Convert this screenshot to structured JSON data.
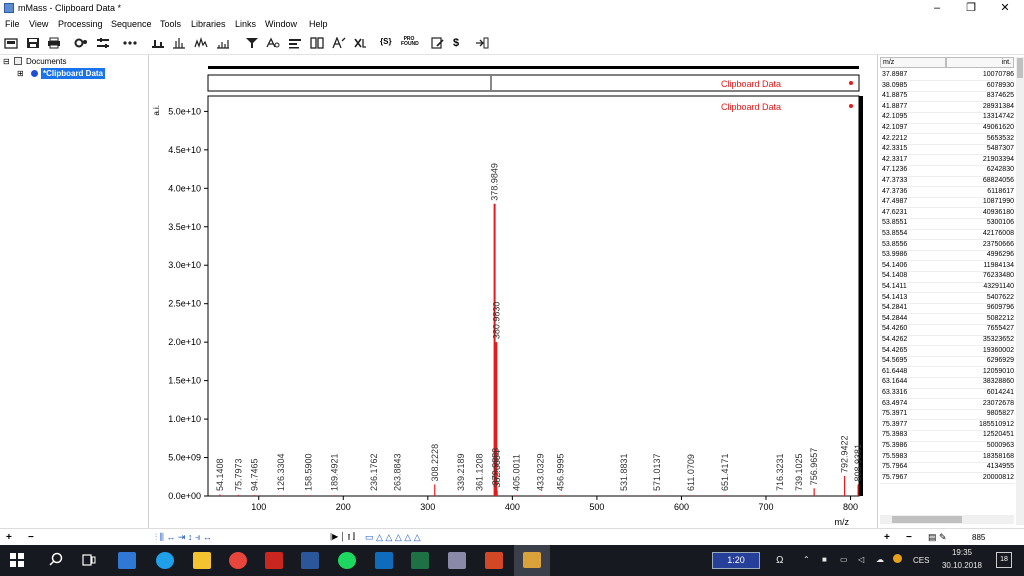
{
  "window": {
    "title": "mMass - Clipboard Data *"
  },
  "menu": [
    "File",
    "View",
    "Processing",
    "Sequence",
    "Tools",
    "Libraries",
    "Links",
    "Window",
    "Help"
  ],
  "toolbar": {
    "icons": [
      "open-icon",
      "save-icon",
      "print-icon",
      "gear-icon",
      "options-icon",
      "more-icon",
      "baseline-icon",
      "peak-picking-icon",
      "smoothing-icon",
      "deisotope-icon",
      "filter-icon",
      "match-icon",
      "compare-icon",
      "mass-filter-icon",
      "envelope-icon",
      "delete-icon",
      "formula-icon",
      "profound-icon",
      "report-icon",
      "currency-icon",
      "export-icon"
    ],
    "profound_label": "PRO FOUND",
    "formula_label": "{S}"
  },
  "tree": {
    "root": "Documents",
    "child": "*Clipboard Data"
  },
  "plot": {
    "legend": "Clipboard Data",
    "top_legend": "Clipboard Data",
    "ylabel": "a.i.",
    "xlabel": "m/z"
  },
  "chart_data": {
    "type": "line",
    "xlabel": "m/z",
    "ylabel": "a.i.",
    "xlim": [
      40,
      810
    ],
    "ylim": [
      0,
      52000000000
    ],
    "x_ticks": [
      100,
      200,
      300,
      400,
      500,
      600,
      700,
      800
    ],
    "y_ticks": [
      0,
      5000000000,
      10000000000,
      15000000000,
      20000000000,
      25000000000,
      30000000000,
      35000000000,
      40000000000,
      45000000000,
      50000000000
    ],
    "y_tick_labels": [
      "0.0e+00",
      "5.0e+09",
      "1.0e+10",
      "1.5e+10",
      "2.0e+10",
      "2.5e+10",
      "3.0e+10",
      "3.5e+10",
      "4.0e+10",
      "4.5e+10",
      "5.0e+10"
    ],
    "peaks": [
      {
        "mz": 54.1408,
        "label": "54.1408",
        "intensity": 200000000
      },
      {
        "mz": 75.7973,
        "label": "75.7973",
        "intensity": 150000000
      },
      {
        "mz": 94.7465,
        "label": "94.7465",
        "intensity": 120000000
      },
      {
        "mz": 126.3304,
        "label": "126.3304",
        "intensity": 100000000
      },
      {
        "mz": 158.59,
        "label": "158.5900",
        "intensity": 100000000
      },
      {
        "mz": 189.4921,
        "label": "189.4921",
        "intensity": 100000000
      },
      {
        "mz": 236.1762,
        "label": "236.1762",
        "intensity": 100000000
      },
      {
        "mz": 263.8843,
        "label": "263.8843",
        "intensity": 100000000
      },
      {
        "mz": 308.2228,
        "label": "308.2228",
        "intensity": 1500000000
      },
      {
        "mz": 339.2189,
        "label": "339.2189",
        "intensity": 100000000
      },
      {
        "mz": 361.1208,
        "label": "361.1208",
        "intensity": 100000000
      },
      {
        "mz": 378.9849,
        "label": "378.9849",
        "intensity": 38000000000
      },
      {
        "mz": 379.9883,
        "label": "379.9883",
        "intensity": 1000000000
      },
      {
        "mz": 380.983,
        "label": "380.9830",
        "intensity": 20000000000
      },
      {
        "mz": 382.0004,
        "label": "382.0004",
        "intensity": 700000000
      },
      {
        "mz": 405.0011,
        "label": "405.0011",
        "intensity": 100000000
      },
      {
        "mz": 433.0329,
        "label": "433.0329",
        "intensity": 100000000
      },
      {
        "mz": 456.9995,
        "label": "456.9995",
        "intensity": 100000000
      },
      {
        "mz": 531.8831,
        "label": "531.8831",
        "intensity": 100000000
      },
      {
        "mz": 571.0137,
        "label": "571.0137",
        "intensity": 100000000
      },
      {
        "mz": 611.0709,
        "label": "611.0709",
        "intensity": 100000000
      },
      {
        "mz": 651.4171,
        "label": "651.4171",
        "intensity": 100000000
      },
      {
        "mz": 716.3231,
        "label": "716.3231",
        "intensity": 100000000
      },
      {
        "mz": 739.1025,
        "label": "739.1025",
        "intensity": 100000000
      },
      {
        "mz": 756.9657,
        "label": "756.9657",
        "intensity": 1000000000
      },
      {
        "mz": 792.9422,
        "label": "792.9422",
        "intensity": 2600000000
      },
      {
        "mz": 808.9381,
        "label": "808.9381",
        "intensity": 1500000000
      }
    ],
    "colors": {
      "spectrum": "#e41a1c",
      "axes": "#000000",
      "labels": "#333333"
    }
  },
  "peaklist": {
    "col_mz": "m/z",
    "col_int": "int.",
    "rows": [
      [
        "37.8987",
        "10070786"
      ],
      [
        "38.0985",
        "6078930"
      ],
      [
        "41.8875",
        "8374625"
      ],
      [
        "41.8877",
        "28931384"
      ],
      [
        "42.1095",
        "13314742"
      ],
      [
        "42.1097",
        "49061620"
      ],
      [
        "42.2212",
        "5653532"
      ],
      [
        "42.3315",
        "5487307"
      ],
      [
        "42.3317",
        "21903394"
      ],
      [
        "47.1236",
        "6242830"
      ],
      [
        "47.3733",
        "68824056"
      ],
      [
        "47.3736",
        "6118617"
      ],
      [
        "47.4987",
        "10871990"
      ],
      [
        "47.6231",
        "40936180"
      ],
      [
        "53.8551",
        "5300106"
      ],
      [
        "53.8554",
        "42176008"
      ],
      [
        "53.8556",
        "23750666"
      ],
      [
        "53.9986",
        "4996296"
      ],
      [
        "54.1406",
        "11984134"
      ],
      [
        "54.1408",
        "76233480"
      ],
      [
        "54.1411",
        "43291140"
      ],
      [
        "54.1413",
        "5407622"
      ],
      [
        "54.2841",
        "9609796"
      ],
      [
        "54.2844",
        "5082212"
      ],
      [
        "54.4260",
        "7655427"
      ],
      [
        "54.4262",
        "35323652"
      ],
      [
        "54.4265",
        "19360002"
      ],
      [
        "54.5695",
        "6296929"
      ],
      [
        "61.6448",
        "12059010"
      ],
      [
        "63.1644",
        "38328860"
      ],
      [
        "63.3316",
        "6014241"
      ],
      [
        "63.4974",
        "23072678"
      ],
      [
        "75.3971",
        "9805827"
      ],
      [
        "75.3977",
        "185510912"
      ],
      [
        "75.3983",
        "12520451"
      ],
      [
        "75.3986",
        "5000963"
      ],
      [
        "75.5983",
        "18358168"
      ],
      [
        "75.7964",
        "4134955"
      ],
      [
        "75.7967",
        "20000812"
      ]
    ],
    "count": "885"
  },
  "statusbar": {
    "peak_count": "885"
  },
  "taskbar": {
    "clock_time": "19:35",
    "clock_date": "30.10.2018",
    "language": "CES",
    "media_time": "1:20",
    "notification_count": "18"
  }
}
